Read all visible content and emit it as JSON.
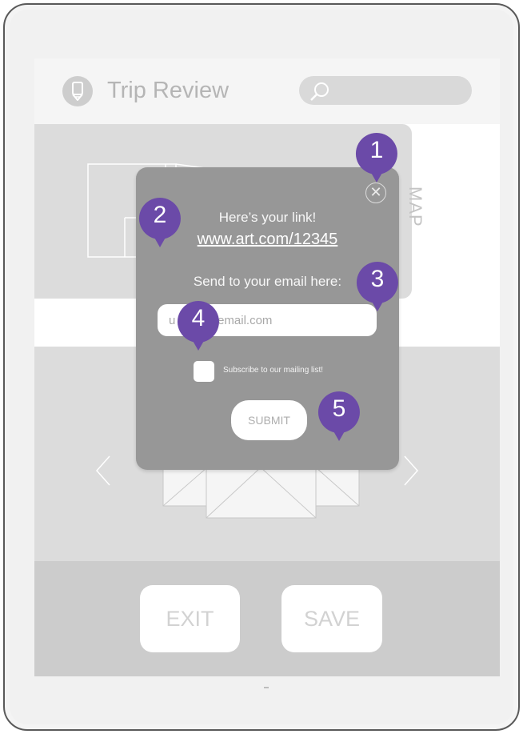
{
  "app": {
    "title": "Trip Review",
    "logo_icon": "pencil-icon",
    "search_icon": "search-icon"
  },
  "map": {
    "label": "MAP"
  },
  "footer": {
    "exit_label": "EXIT",
    "save_label": "SAVE"
  },
  "modal": {
    "close_icon": "close-icon",
    "link_caption": "Here’s your link!",
    "link_url": "www.art.com/12345",
    "email_caption": "Send to your email here:",
    "email_value": "u         @email.com",
    "subscribe_label": "Subscribe to our mailing list!",
    "submit_label": "SUBMIT"
  },
  "markers": [
    "1",
    "2",
    "3",
    "4",
    "5"
  ],
  "colors": {
    "marker": "#6b4aa8",
    "modal": "#979797",
    "panel": "#dcdcdc",
    "footer": "#cccccc"
  }
}
